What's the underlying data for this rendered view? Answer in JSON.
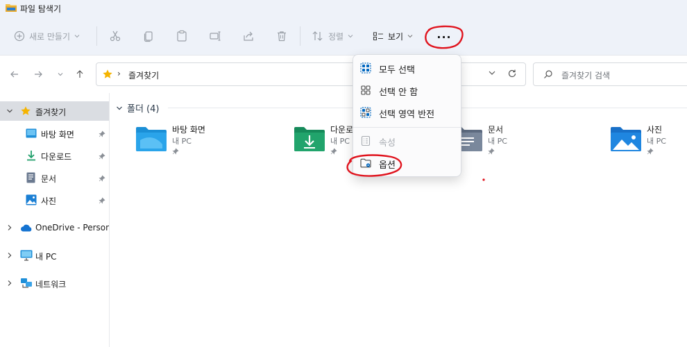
{
  "window": {
    "title": "파일 탐색기"
  },
  "toolbar": {
    "new_label": "새로 만들기",
    "sort_label": "정렬",
    "view_label": "보기",
    "more_label": "···",
    "icons": [
      "cut-icon",
      "copy-icon",
      "paste-icon",
      "rename-icon",
      "share-icon",
      "delete-icon"
    ]
  },
  "address": {
    "path": "즐겨찾기",
    "search_placeholder": "즐겨찾기 검색"
  },
  "sidebar": {
    "items": [
      {
        "label": "즐겨찾기",
        "icon": "star-icon",
        "level": 0,
        "expanded": true,
        "selected": true
      },
      {
        "label": "바탕 화면",
        "icon": "desktop-icon",
        "level": 1,
        "pinned": true
      },
      {
        "label": "다운로드",
        "icon": "download-icon",
        "level": 1,
        "pinned": true
      },
      {
        "label": "문서",
        "icon": "document-icon",
        "level": 1,
        "pinned": true
      },
      {
        "label": "사진",
        "icon": "pictures-icon",
        "level": 1,
        "pinned": true
      },
      {
        "label": "OneDrive - Persona",
        "icon": "cloud-icon",
        "level": 0,
        "expanded": false
      },
      {
        "label": "내 PC",
        "icon": "pc-icon",
        "level": 0,
        "expanded": false
      },
      {
        "label": "네트워크",
        "icon": "network-icon",
        "level": 0,
        "expanded": false
      }
    ]
  },
  "content": {
    "group_label": "폴더 (4)",
    "tiles": [
      {
        "name": "바탕 화면",
        "location": "내 PC",
        "icon": "desktop-folder-icon"
      },
      {
        "name": "다운로드",
        "location": "내 PC",
        "icon": "download-folder-icon"
      },
      {
        "name": "문서",
        "location": "내 PC",
        "icon": "document-folder-icon"
      },
      {
        "name": "사진",
        "location": "내 PC",
        "icon": "pictures-folder-icon"
      }
    ]
  },
  "menu": {
    "items": [
      {
        "label": "모두 선택",
        "icon": "select-all-icon",
        "enabled": true
      },
      {
        "label": "선택 안 함",
        "icon": "select-none-icon",
        "enabled": true
      },
      {
        "label": "선택 영역 반전",
        "icon": "invert-selection-icon",
        "enabled": true
      },
      {
        "label": "속성",
        "icon": "properties-icon",
        "enabled": false
      },
      {
        "label": "옵션",
        "icon": "options-icon",
        "enabled": true
      }
    ]
  },
  "colors": {
    "accent": "#0067c0",
    "annotation": "#e0141e",
    "chrome": "#eef2f9",
    "folder": "#3a9de0"
  }
}
